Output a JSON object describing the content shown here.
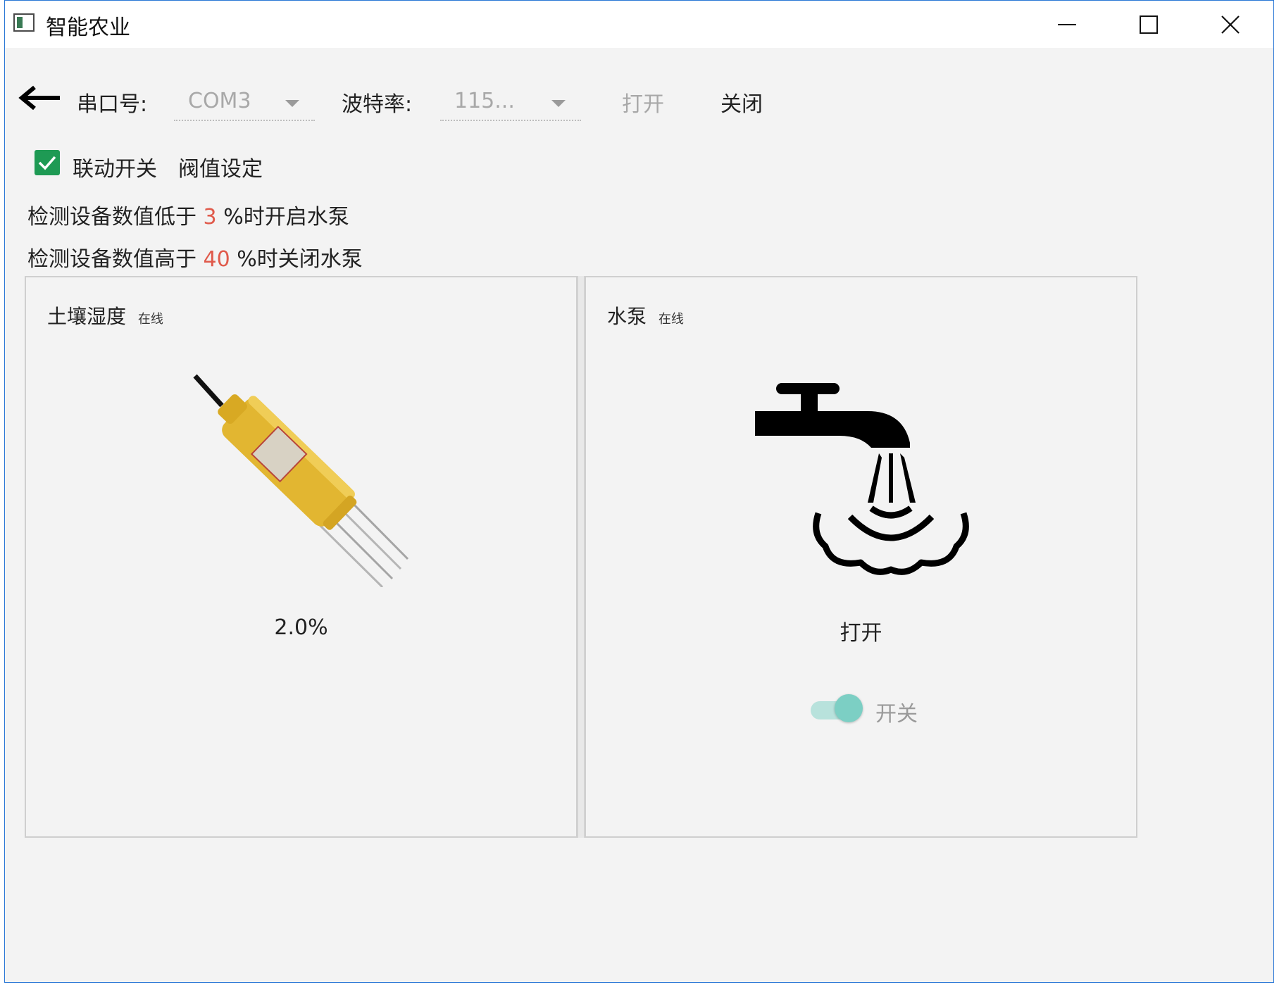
{
  "window": {
    "title": "智能农业",
    "accent": "#2b78d6"
  },
  "toolbar": {
    "back_icon": "arrow-left-icon",
    "port_label": "串口号:",
    "port_value": "COM3",
    "baud_label": "波特率:",
    "baud_value": "115...",
    "open_label": "打开",
    "close_label": "关闭"
  },
  "options": {
    "linkage_checked": true,
    "linkage_label": "联动开关",
    "threshold_label": "阀值设定",
    "check_color": "#1e9a54"
  },
  "thresholds": {
    "low_prefix": "检测设备数值低于",
    "low_value": "3",
    "low_suffix": "%时开启水泵",
    "high_prefix": "检测设备数值高于",
    "high_value": "40",
    "high_suffix": "%时关闭水泵",
    "value_color": "#e05a4b"
  },
  "cards": {
    "soil": {
      "title": "土壤湿度",
      "status": "在线",
      "value": "2.0%",
      "image": "soil-moisture-sensor-icon"
    },
    "pump": {
      "title": "水泵",
      "status": "在线",
      "state": "打开",
      "image": "water-faucet-icon",
      "switch_label": "开关",
      "switch_on": true,
      "switch_color": "#7ccfc4"
    }
  }
}
